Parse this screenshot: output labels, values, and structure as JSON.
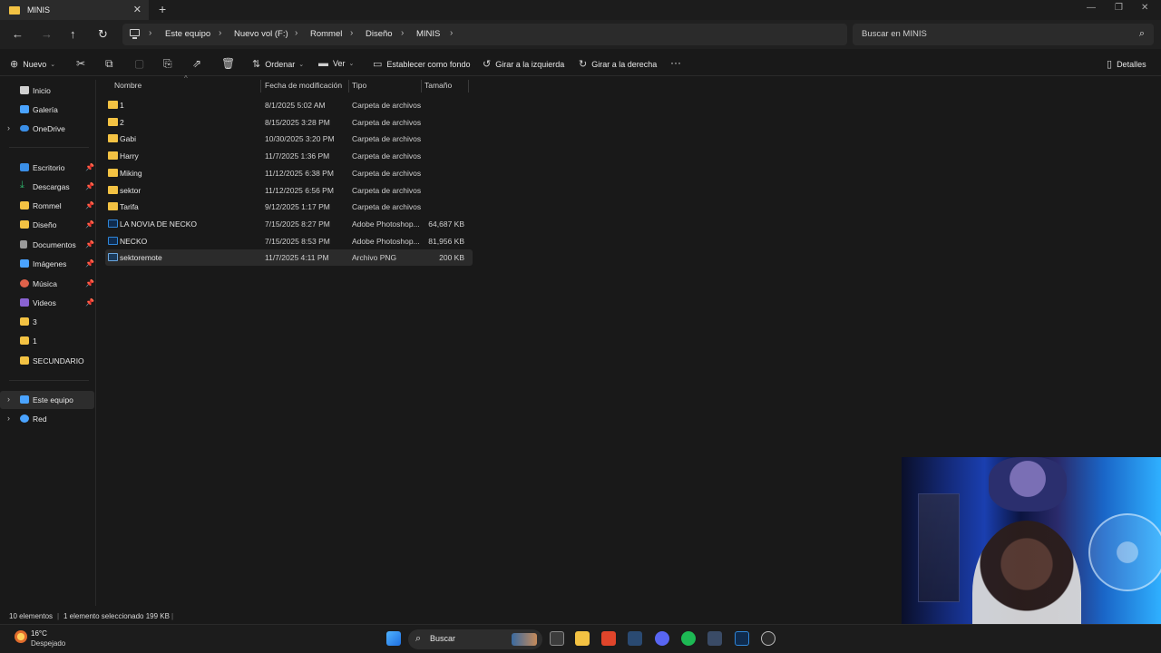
{
  "window": {
    "tab_title": "MINIS",
    "tab_close": "✕",
    "new_tab": "+"
  },
  "address": {
    "crumbs": [
      "Este equipo",
      "Nuevo vol (F:)",
      "Rommel",
      "Diseño",
      "MINIS"
    ],
    "search_placeholder": "Buscar en MINIS"
  },
  "toolbar": {
    "new_label": "Nuevo",
    "sort_label": "Ordenar",
    "view_label": "Ver",
    "set_background_label": "Establecer como fondo",
    "rotate_left_label": "Girar a la izquierda",
    "rotate_right_label": "Girar a la derecha",
    "more_label": "···",
    "details_label": "Detalles"
  },
  "sidebar": {
    "items": [
      {
        "label": "Inicio",
        "icon": "home-icon",
        "color": "#d0d0d0"
      },
      {
        "label": "Galería",
        "icon": "gallery-icon",
        "color": "#4aa3ff"
      },
      {
        "label": "OneDrive",
        "icon": "cloud-icon",
        "color": "#3a8ee6"
      },
      {
        "label": "Escritorio",
        "icon": "desktop-icon",
        "color": "#3a8ee6"
      },
      {
        "label": "Descargas",
        "icon": "download-icon",
        "color": "#2fb36b"
      },
      {
        "label": "Rommel",
        "icon": "folder-icon",
        "color": "#f3c243"
      },
      {
        "label": "Diseño",
        "icon": "folder-icon",
        "color": "#f3c243"
      },
      {
        "label": "Documentos",
        "icon": "documents-icon",
        "color": "#9a9a9a"
      },
      {
        "label": "Imágenes",
        "icon": "pictures-icon",
        "color": "#4aa3ff"
      },
      {
        "label": "Música",
        "icon": "music-icon",
        "color": "#e0624a"
      },
      {
        "label": "Videos",
        "icon": "videos-icon",
        "color": "#8a63d2"
      },
      {
        "label": "3",
        "icon": "folder-icon",
        "color": "#f3c243"
      },
      {
        "label": "1",
        "icon": "folder-icon",
        "color": "#f3c243"
      },
      {
        "label": "SECUNDARIO",
        "icon": "folder-icon",
        "color": "#f3c243"
      },
      {
        "label": "Este equipo",
        "icon": "computer-icon",
        "color": "#4aa3ff"
      },
      {
        "label": "Red",
        "icon": "network-icon",
        "color": "#4aa3ff"
      }
    ]
  },
  "columns": {
    "name": "Nombre",
    "date": "Fecha de modificación",
    "type": "Tipo",
    "size": "Tamaño"
  },
  "files": [
    {
      "name": "1",
      "date": "8/1/2025 5:02 AM",
      "type": "Carpeta de archivos",
      "size": "",
      "kind": "folder"
    },
    {
      "name": "2",
      "date": "8/15/2025 3:28 PM",
      "type": "Carpeta de archivos",
      "size": "",
      "kind": "folder"
    },
    {
      "name": "Gabi",
      "date": "10/30/2025 3:20 PM",
      "type": "Carpeta de archivos",
      "size": "",
      "kind": "folder"
    },
    {
      "name": "Harry",
      "date": "11/7/2025 1:36 PM",
      "type": "Carpeta de archivos",
      "size": "",
      "kind": "folder"
    },
    {
      "name": "Miking",
      "date": "11/12/2025 6:38 PM",
      "type": "Carpeta de archivos",
      "size": "",
      "kind": "folder"
    },
    {
      "name": "sektor",
      "date": "11/12/2025 6:56 PM",
      "type": "Carpeta de archivos",
      "size": "",
      "kind": "folder"
    },
    {
      "name": "Tarifa",
      "date": "9/12/2025 1:17 PM",
      "type": "Carpeta de archivos",
      "size": "",
      "kind": "folder"
    },
    {
      "name": "LA NOVIA DE NECKO",
      "date": "7/15/2025 8:27 PM",
      "type": "Adobe Photoshop...",
      "size": "64,687 KB",
      "kind": "psd"
    },
    {
      "name": "NECKO",
      "date": "7/15/2025 8:53 PM",
      "type": "Adobe Photoshop...",
      "size": "81,956 KB",
      "kind": "psd"
    },
    {
      "name": "sektoremote",
      "date": "11/7/2025 4:11 PM",
      "type": "Archivo PNG",
      "size": "200 KB",
      "kind": "png"
    }
  ],
  "status": {
    "count": "10 elementos",
    "selection": "1 elemento seleccionado 199 KB"
  },
  "taskbar": {
    "weather_temp": "16°C",
    "weather_desc": "Despejado",
    "search_label": "Buscar"
  }
}
